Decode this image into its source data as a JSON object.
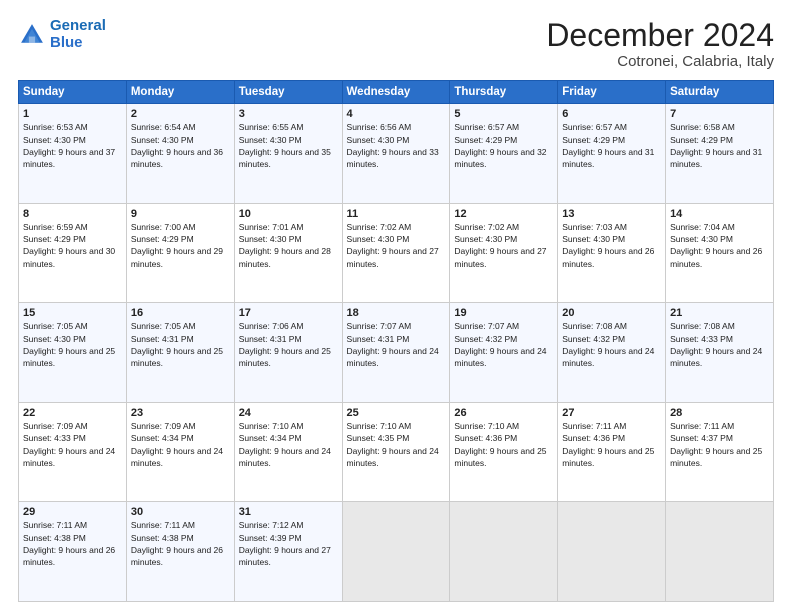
{
  "header": {
    "logo_line1": "General",
    "logo_line2": "Blue",
    "title": "December 2024",
    "subtitle": "Cotronei, Calabria, Italy"
  },
  "weekdays": [
    "Sunday",
    "Monday",
    "Tuesday",
    "Wednesday",
    "Thursday",
    "Friday",
    "Saturday"
  ],
  "weeks": [
    [
      {
        "day": 1,
        "sunrise": "6:53 AM",
        "sunset": "4:30 PM",
        "daylight": "9 hours and 37 minutes."
      },
      {
        "day": 2,
        "sunrise": "6:54 AM",
        "sunset": "4:30 PM",
        "daylight": "9 hours and 36 minutes."
      },
      {
        "day": 3,
        "sunrise": "6:55 AM",
        "sunset": "4:30 PM",
        "daylight": "9 hours and 35 minutes."
      },
      {
        "day": 4,
        "sunrise": "6:56 AM",
        "sunset": "4:30 PM",
        "daylight": "9 hours and 33 minutes."
      },
      {
        "day": 5,
        "sunrise": "6:57 AM",
        "sunset": "4:29 PM",
        "daylight": "9 hours and 32 minutes."
      },
      {
        "day": 6,
        "sunrise": "6:57 AM",
        "sunset": "4:29 PM",
        "daylight": "9 hours and 31 minutes."
      },
      {
        "day": 7,
        "sunrise": "6:58 AM",
        "sunset": "4:29 PM",
        "daylight": "9 hours and 31 minutes."
      }
    ],
    [
      {
        "day": 8,
        "sunrise": "6:59 AM",
        "sunset": "4:29 PM",
        "daylight": "9 hours and 30 minutes."
      },
      {
        "day": 9,
        "sunrise": "7:00 AM",
        "sunset": "4:29 PM",
        "daylight": "9 hours and 29 minutes."
      },
      {
        "day": 10,
        "sunrise": "7:01 AM",
        "sunset": "4:30 PM",
        "daylight": "9 hours and 28 minutes."
      },
      {
        "day": 11,
        "sunrise": "7:02 AM",
        "sunset": "4:30 PM",
        "daylight": "9 hours and 27 minutes."
      },
      {
        "day": 12,
        "sunrise": "7:02 AM",
        "sunset": "4:30 PM",
        "daylight": "9 hours and 27 minutes."
      },
      {
        "day": 13,
        "sunrise": "7:03 AM",
        "sunset": "4:30 PM",
        "daylight": "9 hours and 26 minutes."
      },
      {
        "day": 14,
        "sunrise": "7:04 AM",
        "sunset": "4:30 PM",
        "daylight": "9 hours and 26 minutes."
      }
    ],
    [
      {
        "day": 15,
        "sunrise": "7:05 AM",
        "sunset": "4:30 PM",
        "daylight": "9 hours and 25 minutes."
      },
      {
        "day": 16,
        "sunrise": "7:05 AM",
        "sunset": "4:31 PM",
        "daylight": "9 hours and 25 minutes."
      },
      {
        "day": 17,
        "sunrise": "7:06 AM",
        "sunset": "4:31 PM",
        "daylight": "9 hours and 25 minutes."
      },
      {
        "day": 18,
        "sunrise": "7:07 AM",
        "sunset": "4:31 PM",
        "daylight": "9 hours and 24 minutes."
      },
      {
        "day": 19,
        "sunrise": "7:07 AM",
        "sunset": "4:32 PM",
        "daylight": "9 hours and 24 minutes."
      },
      {
        "day": 20,
        "sunrise": "7:08 AM",
        "sunset": "4:32 PM",
        "daylight": "9 hours and 24 minutes."
      },
      {
        "day": 21,
        "sunrise": "7:08 AM",
        "sunset": "4:33 PM",
        "daylight": "9 hours and 24 minutes."
      }
    ],
    [
      {
        "day": 22,
        "sunrise": "7:09 AM",
        "sunset": "4:33 PM",
        "daylight": "9 hours and 24 minutes."
      },
      {
        "day": 23,
        "sunrise": "7:09 AM",
        "sunset": "4:34 PM",
        "daylight": "9 hours and 24 minutes."
      },
      {
        "day": 24,
        "sunrise": "7:10 AM",
        "sunset": "4:34 PM",
        "daylight": "9 hours and 24 minutes."
      },
      {
        "day": 25,
        "sunrise": "7:10 AM",
        "sunset": "4:35 PM",
        "daylight": "9 hours and 24 minutes."
      },
      {
        "day": 26,
        "sunrise": "7:10 AM",
        "sunset": "4:36 PM",
        "daylight": "9 hours and 25 minutes."
      },
      {
        "day": 27,
        "sunrise": "7:11 AM",
        "sunset": "4:36 PM",
        "daylight": "9 hours and 25 minutes."
      },
      {
        "day": 28,
        "sunrise": "7:11 AM",
        "sunset": "4:37 PM",
        "daylight": "9 hours and 25 minutes."
      }
    ],
    [
      {
        "day": 29,
        "sunrise": "7:11 AM",
        "sunset": "4:38 PM",
        "daylight": "9 hours and 26 minutes."
      },
      {
        "day": 30,
        "sunrise": "7:11 AM",
        "sunset": "4:38 PM",
        "daylight": "9 hours and 26 minutes."
      },
      {
        "day": 31,
        "sunrise": "7:12 AM",
        "sunset": "4:39 PM",
        "daylight": "9 hours and 27 minutes."
      },
      null,
      null,
      null,
      null
    ]
  ]
}
